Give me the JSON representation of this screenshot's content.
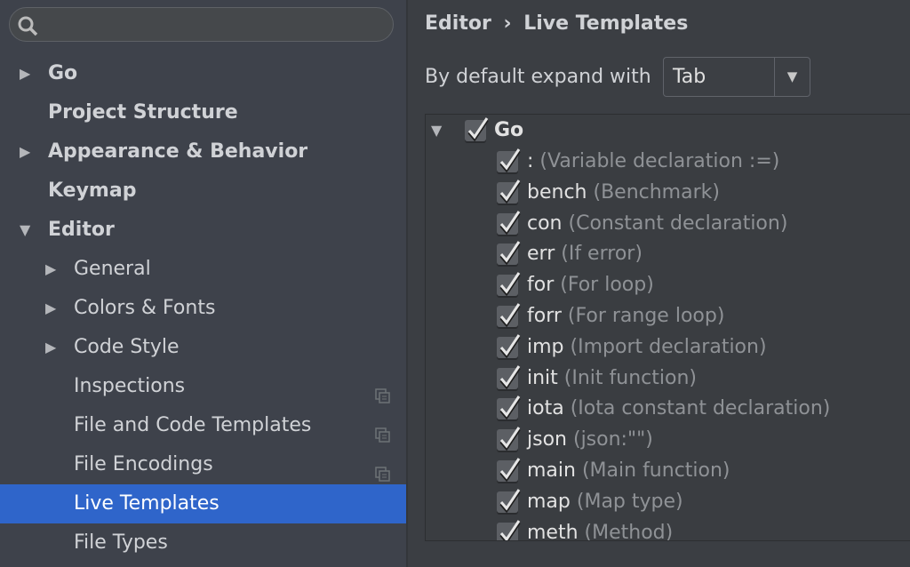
{
  "sidebar": {
    "search_placeholder": "",
    "items": [
      {
        "label": "Go",
        "expander": "collapsed",
        "bold": true,
        "level": 0
      },
      {
        "label": "Project Structure",
        "bold": true,
        "level": 0
      },
      {
        "label": "Appearance & Behavior",
        "expander": "collapsed",
        "bold": true,
        "level": 0
      },
      {
        "label": "Keymap",
        "bold": true,
        "level": 0
      },
      {
        "label": "Editor",
        "expander": "expanded",
        "bold": true,
        "level": 0
      },
      {
        "label": "General",
        "expander": "collapsed",
        "level": 1
      },
      {
        "label": "Colors & Fonts",
        "expander": "collapsed",
        "level": 1
      },
      {
        "label": "Code Style",
        "expander": "collapsed",
        "level": 1
      },
      {
        "label": "Inspections",
        "level": 1,
        "project_icon": true
      },
      {
        "label": "File and Code Templates",
        "level": 1,
        "project_icon": true
      },
      {
        "label": "File Encodings",
        "level": 1,
        "project_icon": true
      },
      {
        "label": "Live Templates",
        "level": 1,
        "selected": true
      },
      {
        "label": "File Types",
        "level": 1
      }
    ]
  },
  "breadcrumb": {
    "parent": "Editor",
    "separator": "›",
    "current": "Live Templates"
  },
  "expand": {
    "label": "By default expand with",
    "value": "Tab"
  },
  "tree": {
    "group": {
      "label": "Go",
      "checked": true,
      "expanded": true
    },
    "templates": [
      {
        "key": ":",
        "desc": "(Variable declaration :=)",
        "checked": true
      },
      {
        "key": "bench",
        "desc": "(Benchmark)",
        "checked": true
      },
      {
        "key": "con",
        "desc": "(Constant declaration)",
        "checked": true
      },
      {
        "key": "err",
        "desc": "(If error)",
        "checked": true
      },
      {
        "key": "for",
        "desc": "(For loop)",
        "checked": true
      },
      {
        "key": "forr",
        "desc": "(For range loop)",
        "checked": true
      },
      {
        "key": "imp",
        "desc": "(Import declaration)",
        "checked": true
      },
      {
        "key": "init",
        "desc": "(Init function)",
        "checked": true
      },
      {
        "key": "iota",
        "desc": "(Iota constant declaration)",
        "checked": true
      },
      {
        "key": "json",
        "desc": "(json:\"\")",
        "checked": true
      },
      {
        "key": "main",
        "desc": "(Main function)",
        "checked": true
      },
      {
        "key": "map",
        "desc": "(Map type)",
        "checked": true
      },
      {
        "key": "meth",
        "desc": "(Method)",
        "checked": true
      }
    ]
  },
  "colors": {
    "selection": "#2f65ca"
  }
}
